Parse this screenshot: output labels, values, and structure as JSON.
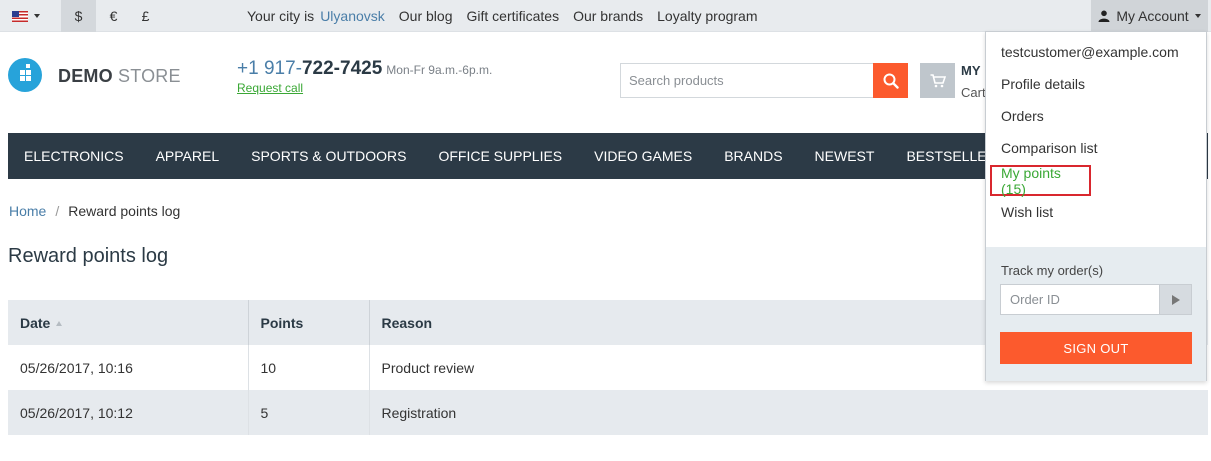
{
  "topbar": {
    "language_icon": "us-flag-icon",
    "currencies": [
      "$",
      "€",
      "£"
    ],
    "active_currency": "$",
    "city_label": "Your city is",
    "city_value": "Ulyanovsk",
    "links": [
      "Our blog",
      "Gift certificates",
      "Our brands",
      "Loyalty program"
    ],
    "account_label": "My Account"
  },
  "header": {
    "brand_bold": "DEMO",
    "brand_light": "STORE",
    "phone_prefix": "+1 917-",
    "phone_main": "722-7425",
    "hours": "Mon-Fr 9a.m.-6p.m.",
    "request_call": "Request call",
    "search_placeholder": "Search products",
    "cart_title": "MY",
    "cart_sub": "Cart"
  },
  "nav": {
    "items": [
      "ELECTRONICS",
      "APPAREL",
      "SPORTS & OUTDOORS",
      "OFFICE SUPPLIES",
      "VIDEO GAMES",
      "BRANDS",
      "NEWEST",
      "BESTSELLERS"
    ]
  },
  "breadcrumb": {
    "home": "Home",
    "separator": "/",
    "current": "Reward points log"
  },
  "page": {
    "title": "Reward points log"
  },
  "table": {
    "headers": [
      "Date",
      "Points",
      "Reason"
    ],
    "rows": [
      [
        "05/26/2017, 10:16",
        "10",
        "Product review"
      ],
      [
        "05/26/2017, 10:12",
        "5",
        "Registration"
      ]
    ]
  },
  "account_dropdown": {
    "email": "testcustomer@example.com",
    "items": [
      "Profile details",
      "Orders",
      "Comparison list",
      "My points (15)",
      "Wish list"
    ],
    "track_label": "Track my order(s)",
    "order_placeholder": "Order ID",
    "signout": "SIGN OUT"
  },
  "colors": {
    "accent_orange": "#fc5a2d",
    "nav_bg": "#2c3a46",
    "link_blue": "#4a7ea8",
    "green": "#3aa835",
    "highlight_red": "#d9272e"
  }
}
